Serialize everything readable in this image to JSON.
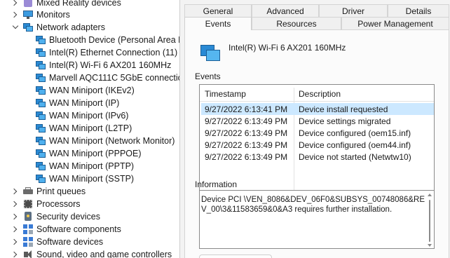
{
  "tree": {
    "items": [
      {
        "label": "Mixed Reality devices",
        "icon": "mixed-reality-icon",
        "expander": "right"
      },
      {
        "label": "Monitors",
        "icon": "monitor-icon",
        "expander": "right"
      },
      {
        "label": "Network adapters",
        "icon": "network-adapter-icon",
        "expander": "down"
      },
      {
        "label": "Bluetooth Device (Personal Area Ne",
        "icon": "network-adapter-icon"
      },
      {
        "label": "Intel(R) Ethernet Connection (11) I2",
        "icon": "network-adapter-icon"
      },
      {
        "label": "Intel(R) Wi-Fi 6 AX201 160MHz",
        "icon": "network-adapter-icon"
      },
      {
        "label": "Marvell AQC111C 5GbE connection",
        "icon": "network-adapter-icon"
      },
      {
        "label": "WAN Miniport (IKEv2)",
        "icon": "network-adapter-icon"
      },
      {
        "label": "WAN Miniport (IP)",
        "icon": "network-adapter-icon"
      },
      {
        "label": "WAN Miniport (IPv6)",
        "icon": "network-adapter-icon"
      },
      {
        "label": "WAN Miniport (L2TP)",
        "icon": "network-adapter-icon"
      },
      {
        "label": "WAN Miniport (Network Monitor)",
        "icon": "network-adapter-icon"
      },
      {
        "label": "WAN Miniport (PPPOE)",
        "icon": "network-adapter-icon"
      },
      {
        "label": "WAN Miniport (PPTP)",
        "icon": "network-adapter-icon"
      },
      {
        "label": "WAN Miniport (SSTP)",
        "icon": "network-adapter-icon"
      },
      {
        "label": "Print queues",
        "icon": "printer-icon",
        "expander": "right"
      },
      {
        "label": "Processors",
        "icon": "processor-icon",
        "expander": "right"
      },
      {
        "label": "Security devices",
        "icon": "security-device-icon",
        "expander": "right"
      },
      {
        "label": "Software components",
        "icon": "software-component-icon",
        "expander": "right"
      },
      {
        "label": "Software devices",
        "icon": "software-device-icon",
        "expander": "right"
      },
      {
        "label": "Sound, video and game controllers",
        "icon": "sound-icon",
        "expander": "right"
      }
    ]
  },
  "dialog": {
    "tabs_row1": [
      "General",
      "Advanced",
      "Driver",
      "Details"
    ],
    "tabs_row2": [
      "Events",
      "Resources",
      "Power Management"
    ],
    "active_tab": "Events",
    "device_name": "Intel(R) Wi-Fi 6 AX201 160MHz",
    "device_icon": "network-adapter-icon",
    "events_label": "Events",
    "columns": [
      "Timestamp",
      "Description"
    ],
    "rows": [
      {
        "timestamp": "9/27/2022 6:13:41 PM",
        "description": "Device install requested",
        "selected": true
      },
      {
        "timestamp": "9/27/2022 6:13:49 PM",
        "description": "Device settings migrated"
      },
      {
        "timestamp": "9/27/2022 6:13:49 PM",
        "description": "Device configured (oem15.inf)"
      },
      {
        "timestamp": "9/27/2022 6:13:49 PM",
        "description": "Device configured (oem44.inf)"
      },
      {
        "timestamp": "9/27/2022 6:13:49 PM",
        "description": "Device not started (Netwtw10)"
      }
    ],
    "information_label": "Information",
    "information_text": "Device PCI \\VEN_8086&DEV_06F0&SUBSYS_00748086&REV_00\\3&11583659&0&A3 requires further installation."
  }
}
